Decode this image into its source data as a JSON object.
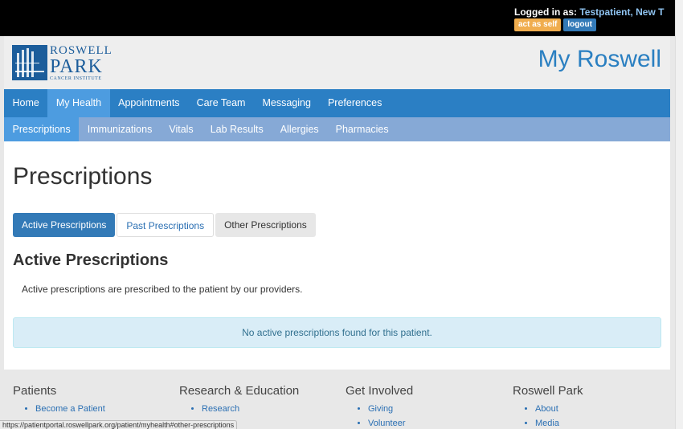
{
  "topbar": {
    "logged_in_label": "Logged in as:",
    "user_name": "Testpatient, New T",
    "act_as_self_label": "act as self",
    "logout_label": "logout"
  },
  "header": {
    "logo": {
      "line1": "ROSWELL",
      "line2": "PARK",
      "line3": "CANCER INSTITUTE"
    },
    "brand_title": "My Roswell"
  },
  "nav_primary": [
    {
      "label": "Home",
      "active": false
    },
    {
      "label": "My Health",
      "active": true
    },
    {
      "label": "Appointments",
      "active": false
    },
    {
      "label": "Care Team",
      "active": false
    },
    {
      "label": "Messaging",
      "active": false
    },
    {
      "label": "Preferences",
      "active": false
    }
  ],
  "nav_secondary": [
    {
      "label": "Prescriptions",
      "active": true
    },
    {
      "label": "Immunizations",
      "active": false
    },
    {
      "label": "Vitals",
      "active": false
    },
    {
      "label": "Lab Results",
      "active": false
    },
    {
      "label": "Allergies",
      "active": false
    },
    {
      "label": "Pharmacies",
      "active": false
    }
  ],
  "main": {
    "page_title": "Prescriptions",
    "tabs": [
      {
        "label": "Active Prescriptions",
        "state": "active"
      },
      {
        "label": "Past Prescriptions",
        "state": "link"
      },
      {
        "label": "Other Prescriptions",
        "state": "default"
      }
    ],
    "section_title": "Active Prescriptions",
    "description": "Active prescriptions are prescribed to the patient by our providers.",
    "empty_message": "No active prescriptions found for this patient."
  },
  "footer": {
    "columns": [
      {
        "heading": "Patients",
        "links": [
          "Become a Patient"
        ]
      },
      {
        "heading": "Research & Education",
        "links": [
          "Research"
        ]
      },
      {
        "heading": "Get Involved",
        "links": [
          "Giving",
          "Volunteer"
        ]
      },
      {
        "heading": "Roswell Park",
        "links": [
          "About",
          "Media"
        ]
      }
    ]
  },
  "status_url": "https://patientportal.roswellpark.org/patient/myhealth#other-prescriptions",
  "colors": {
    "topbar": "#000000",
    "nav_primary": "#2b7fc4",
    "nav_secondary": "#86a9d6",
    "active_item": "#4d9ce0",
    "brand": "#2a7fc1",
    "alert_bg": "#d9edf7"
  }
}
